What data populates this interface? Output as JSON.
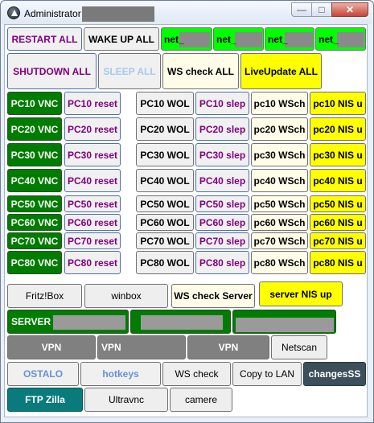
{
  "window": {
    "title": "Administrator",
    "controls": {
      "minimize": "—",
      "maximize": "□",
      "close": "✕"
    }
  },
  "top_row": {
    "restart_all": "RESTART ALL",
    "wake_up_all": "WAKE UP ALL",
    "net": [
      "net_",
      "net_",
      "net_",
      "net_"
    ]
  },
  "second_row": {
    "shutdown_all": "SHUTDOWN ALL",
    "sleep_all": "SLEEP ALL",
    "ws_check_all": "WS check ALL",
    "liveupdate_all": "LiveUpdate ALL"
  },
  "pc_rows": [
    {
      "vnc": "PC10 VNC",
      "reset": "PC10 reset",
      "wol": "PC10 WOL",
      "slep": "PC10 slep",
      "wsch": "pc10 WSch",
      "nis": "pc10 NIS u"
    },
    {
      "vnc": "PC20 VNC",
      "reset": "PC20 reset",
      "wol": "PC20 WOL",
      "slep": "PC20 slep",
      "wsch": "pc20 WSch",
      "nis": "pc20 NIS u"
    },
    {
      "vnc": "PC30 VNC",
      "reset": "PC30 reset",
      "wol": "PC30 WOL",
      "slep": "PC30 slep",
      "wsch": "pc30 WSch",
      "nis": "pc30 NIS u"
    },
    {
      "vnc": "PC40 VNC",
      "reset": "PC40 reset",
      "wol": "PC40 WOL",
      "slep": "PC40 slep",
      "wsch": "pc40 WSch",
      "nis": "pc40 NIS u"
    },
    {
      "vnc": "PC50 VNC",
      "reset": "PC50 reset",
      "wol": "PC50 WOL",
      "slep": "PC50 slep",
      "wsch": "pc50 WSch",
      "nis": "pc50 NIS u"
    },
    {
      "vnc": "PC60 VNC",
      "reset": "PC60 reset",
      "wol": "PC60 WOL",
      "slep": "PC60 slep",
      "wsch": "pc60 WSch",
      "nis": "pc60 NIS u"
    },
    {
      "vnc": "PC70 VNC",
      "reset": "PC70 reset",
      "wol": "PC70 WOL",
      "slep": "PC70 slep",
      "wsch": "pc70 WSch",
      "nis": "pc70 NIS u"
    },
    {
      "vnc": "PC80 VNC",
      "reset": "PC80 reset",
      "wol": "PC80 WOL",
      "slep": "PC80 slep",
      "wsch": "pc80 WSch",
      "nis": "pc80 NIS u"
    }
  ],
  "tools_row": {
    "fritzbox": "Fritz!Box",
    "winbox": "winbox",
    "ws_check_server": "WS check Server",
    "server_nis_up": "server NIS up"
  },
  "server_row": {
    "server": "SERVER"
  },
  "vpn_row": {
    "vpn": [
      "VPN",
      "VPN",
      "VPN"
    ],
    "netscan": "Netscan"
  },
  "misc_row": {
    "ostalo": "OSTALO",
    "hotkeys": "hotkeys",
    "ws_check": "WS check",
    "copy_to_lan": "Copy to LAN",
    "changess": "changesSS"
  },
  "bottom_row": {
    "ftp_zilla": "FTP Zilla",
    "ultravnc": "Ultravnc",
    "camere": "camere"
  },
  "colors": {
    "dark_green": "#007c00",
    "lime": "#00ff00",
    "yellow": "#ffff00",
    "purple_text": "#800080",
    "gray": "#808080",
    "teal": "#0a7b7c",
    "slate": "#3c4f5a"
  }
}
